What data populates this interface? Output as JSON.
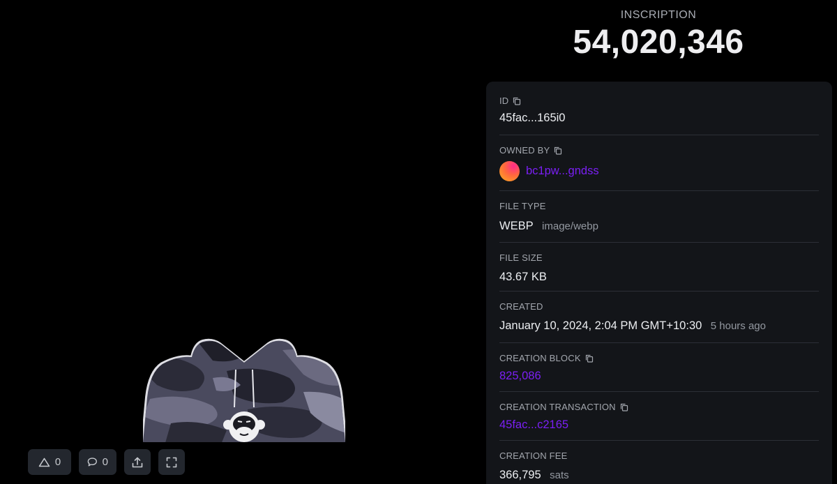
{
  "header": {
    "label": "INSCRIPTION",
    "number": "54,020,346"
  },
  "media": {
    "image_icon": "camo-hoodie-image",
    "actions": [
      {
        "icon": "triangle-icon",
        "count": "0"
      },
      {
        "icon": "comment-icon",
        "count": "0"
      },
      {
        "icon": "share-icon"
      },
      {
        "icon": "fullscreen-icon"
      }
    ]
  },
  "details": {
    "id": {
      "label": "ID",
      "value": "45fac...165i0"
    },
    "owner": {
      "label": "OWNED BY",
      "value": "bc1pw...gndss"
    },
    "file_type": {
      "label": "FILE TYPE",
      "value": "WEBP",
      "mime": "image/webp"
    },
    "file_size": {
      "label": "FILE SIZE",
      "value": "43.67 KB"
    },
    "created": {
      "label": "CREATED",
      "value": "January 10, 2024, 2:04 PM GMT+10:30",
      "relative": "5 hours ago"
    },
    "creation_block": {
      "label": "CREATION BLOCK",
      "value": "825,086"
    },
    "creation_tx": {
      "label": "CREATION TRANSACTION",
      "value": "45fac...c2165"
    },
    "creation_fee": {
      "label": "CREATION FEE",
      "value": "366,795",
      "unit": "sats"
    }
  },
  "colors": {
    "background": "#000000",
    "card": "#131519",
    "link": "#7b1ff5",
    "button": "#23272e"
  }
}
